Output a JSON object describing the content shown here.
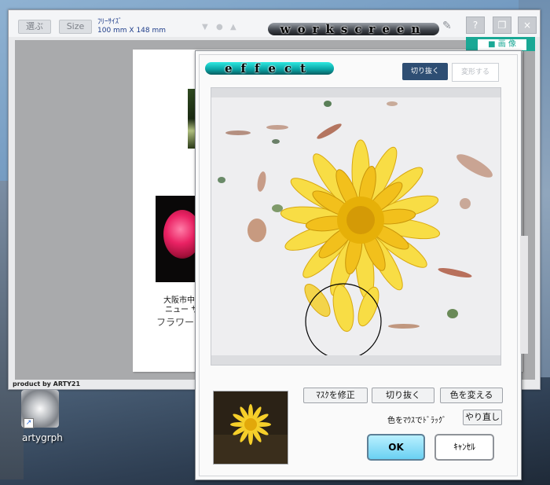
{
  "workscreen": {
    "select_label": "選ぶ",
    "size_label": "Size",
    "size_name": "ﾌﾘｰｻｲｽﾞ",
    "size_dimensions": "100 mm  X  148 mm",
    "logo": "workscreen",
    "help_label": "?",
    "close_label": "×",
    "side_tab_label": "■ 画 像",
    "footer": "product by ARTY21",
    "paper_caption_line1": "大阪市中",
    "paper_caption_line2": "ニュー サ",
    "paper_caption_line3": "フラワー"
  },
  "desktop": {
    "icon_label": "artygrph"
  },
  "effect": {
    "logo": "effect",
    "tab_crop": "切り抜く",
    "tab_deform": "変形する",
    "btn_fix_mask": "ﾏｽｸを修正",
    "btn_cutout": "切り抜く",
    "btn_change_color": "色を変える",
    "drag_hint": "色をﾏｳｽでﾄﾞﾗｯｸﾞ",
    "btn_redo": "やり直し",
    "btn_ok": "OK",
    "btn_cancel": "ｷｬﾝｾﾙ"
  },
  "colors": {
    "accent_teal": "#1aa895",
    "crop_tab": "#2e4e73",
    "ok_button": "#6ad0f2",
    "flower_yellow": "#f6cf2a"
  }
}
